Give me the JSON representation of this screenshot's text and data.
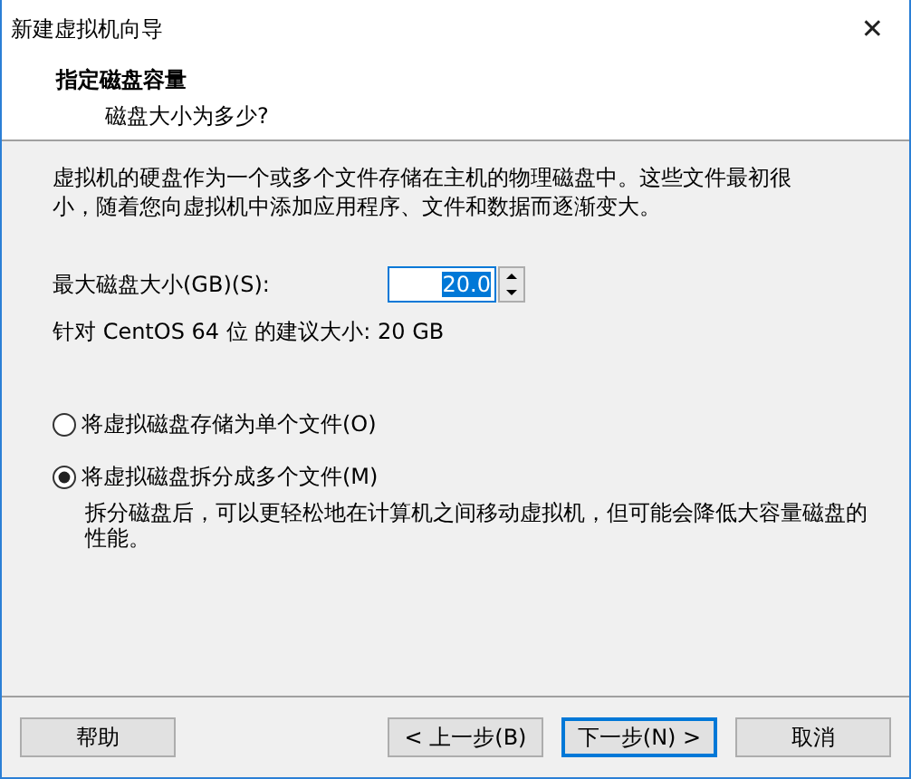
{
  "window": {
    "title": "新建虚拟机向导",
    "close": "✕"
  },
  "header": {
    "title": "指定磁盘容量",
    "subtitle": "磁盘大小为多少?"
  },
  "description": "虚拟机的硬盘作为一个或多个文件存储在主机的物理磁盘中。这些文件最初很小，随着您向虚拟机中添加应用程序、文件和数据而逐渐变大。",
  "size_field": {
    "label": "最大磁盘大小(GB)(S):",
    "value": "20.0"
  },
  "recommendation": "针对 CentOS 64 位 的建议大小: 20 GB",
  "options": [
    {
      "label": "将虚拟磁盘存储为单个文件(O)",
      "selected": false
    },
    {
      "label": "将虚拟磁盘拆分成多个文件(M)",
      "selected": true,
      "note": "拆分磁盘后，可以更轻松地在计算机之间移动虚拟机，但可能会降低大容量磁盘的性能。"
    }
  ],
  "buttons": [
    {
      "label": "帮助",
      "default": false
    },
    {
      "label": "< 上一步(B)",
      "default": false
    },
    {
      "label": "下一步(N) >",
      "default": true
    },
    {
      "label": "取消",
      "default": false
    }
  ]
}
